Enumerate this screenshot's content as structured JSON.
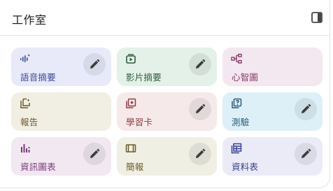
{
  "header": {
    "title": "工作室"
  },
  "tiles": [
    {
      "label": "語音摘要",
      "icon": "audio-waveform-icon",
      "bg": "#e8eafa",
      "color": "#3d4a94",
      "edit": true
    },
    {
      "label": "影片摘要",
      "icon": "video-icon",
      "bg": "#e3f1e8",
      "color": "#2f5d3d",
      "edit": true
    },
    {
      "label": "心智圖",
      "icon": "mind-map-icon",
      "bg": "#f3e8ef",
      "color": "#8a3a6a",
      "edit": false
    },
    {
      "label": "報告",
      "icon": "report-icon",
      "bg": "#f1efe3",
      "color": "#6a5a2e",
      "edit": false
    },
    {
      "label": "學習卡",
      "icon": "flashcards-icon",
      "bg": "#f6e9ea",
      "color": "#933c43",
      "edit": true
    },
    {
      "label": "測驗",
      "icon": "quiz-icon",
      "bg": "#def0f7",
      "color": "#2a5d78",
      "edit": true
    },
    {
      "label": "資訊圖表",
      "icon": "infographic-icon",
      "bg": "#f1e8f1",
      "color": "#7a3a7a",
      "edit": true
    },
    {
      "label": "簡報",
      "icon": "slides-icon",
      "bg": "#f0efe4",
      "color": "#6b5b2a",
      "edit": true
    },
    {
      "label": "資料表",
      "icon": "table-icon",
      "bg": "#ebebf8",
      "color": "#3a4290",
      "edit": true
    }
  ]
}
